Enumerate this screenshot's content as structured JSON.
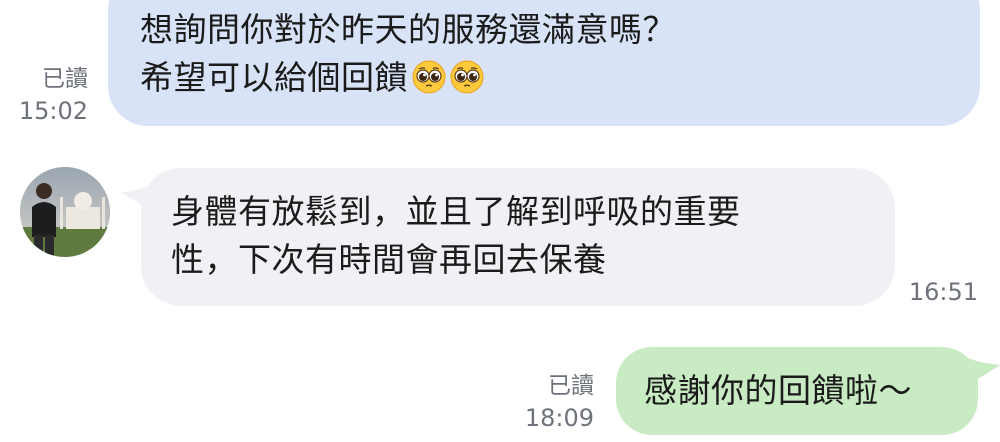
{
  "messages": [
    {
      "direction": "outgoing",
      "lines": [
        "想詢問你對於昨天的服務還滿意嗎？",
        "希望可以給個回饋"
      ],
      "emoji": [
        "pleading-face",
        "pleading-face"
      ],
      "read_label": "已讀",
      "time": "15:02",
      "bubble_color": "#d9e3f7"
    },
    {
      "direction": "incoming",
      "lines": [
        "身體有放鬆到，並且了解到呼吸的重要",
        "性，下次有時間會再回去保養"
      ],
      "time": "16:51",
      "bubble_color": "#f0f1f4"
    },
    {
      "direction": "outgoing",
      "lines": [
        "感謝你的回饋啦～"
      ],
      "read_label": "已讀",
      "time": "18:09",
      "bubble_color": "#c9ebc3"
    }
  ]
}
